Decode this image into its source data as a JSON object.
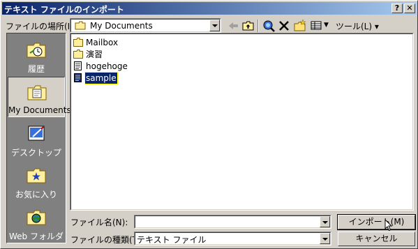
{
  "window": {
    "title": "テキスト ファイルのインポート",
    "help_button": "?",
    "close_button": "✕"
  },
  "location": {
    "label": "ファイルの場所(I):",
    "value": "My Documents"
  },
  "toolbar": {
    "tools_label": "ツール(L)",
    "tools_arrow": "▾"
  },
  "places": [
    {
      "label": "履歴",
      "icon": "history-icon"
    },
    {
      "label": "My Documents",
      "icon": "my-documents-icon",
      "selected": true
    },
    {
      "label": "デスクトップ",
      "icon": "desktop-icon"
    },
    {
      "label": "お気に入り",
      "icon": "favorites-icon"
    },
    {
      "label": "Web フォルダ",
      "icon": "web-folder-icon"
    }
  ],
  "files": [
    {
      "name": "Mailbox",
      "type": "folder"
    },
    {
      "name": "演習",
      "type": "folder"
    },
    {
      "name": "hogehoge",
      "type": "text"
    },
    {
      "name": "sample",
      "type": "text",
      "selected": true
    }
  ],
  "filename": {
    "label": "ファイル名(N):",
    "value": ""
  },
  "filetype": {
    "label": "ファイルの種類(T):",
    "value": "テキスト ファイル"
  },
  "buttons": {
    "import": "インポート(M)",
    "cancel": "キャンセル"
  }
}
